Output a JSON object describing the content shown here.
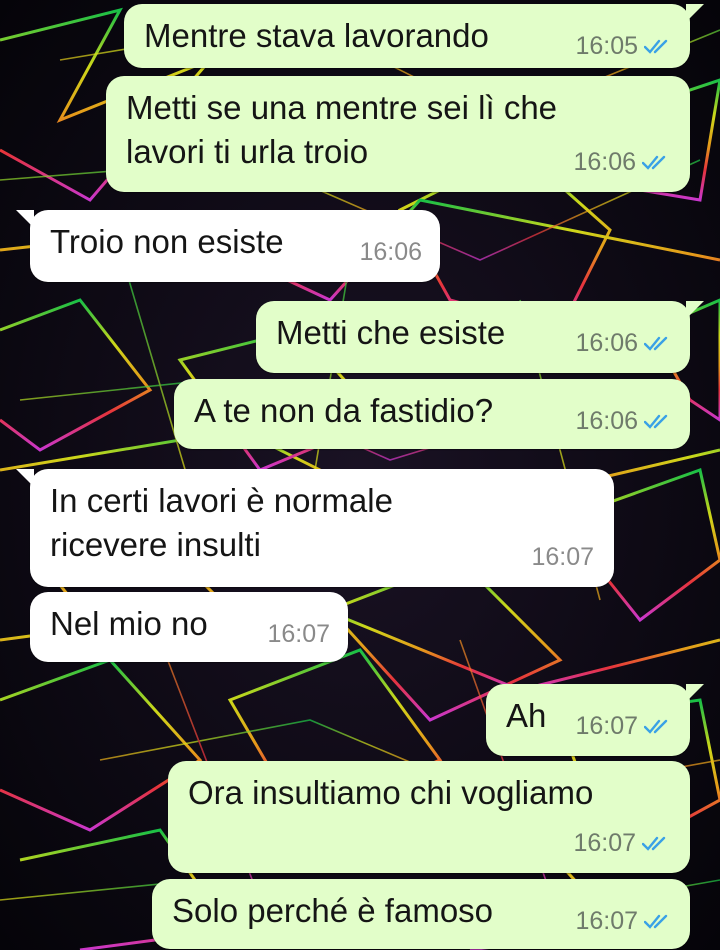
{
  "colors": {
    "outgoing_bubble": "#e2fec9",
    "incoming_bubble": "#ffffff",
    "read_ticks": "#3aa1e6",
    "timestamp": "#6f7b6b"
  },
  "icons": {
    "read_receipt": "double-check-icon"
  },
  "messages": [
    {
      "direction": "out",
      "text": "Mentre stava lavorando",
      "time": "16:05",
      "read": true
    },
    {
      "direction": "out",
      "text": "Metti se una mentre sei lì che\nlavori ti urla troio",
      "time": "16:06",
      "read": true
    },
    {
      "direction": "in",
      "text": "Troio non esiste",
      "time": "16:06"
    },
    {
      "direction": "out",
      "text": "Metti che esiste",
      "time": "16:06",
      "read": true
    },
    {
      "direction": "out",
      "text": "A te non da fastidio?",
      "time": "16:06",
      "read": true
    },
    {
      "direction": "in",
      "text": "In certi lavori è normale\nricevere insulti",
      "time": "16:07"
    },
    {
      "direction": "in",
      "text": "Nel mio no",
      "time": "16:07"
    },
    {
      "direction": "out",
      "text": "Ah",
      "time": "16:07",
      "read": true
    },
    {
      "direction": "out",
      "text": "Ora insultiamo chi vogliamo",
      "time": "16:07",
      "read": true
    },
    {
      "direction": "out",
      "text": "Solo perché è famoso",
      "time": "16:07",
      "read": true
    }
  ]
}
